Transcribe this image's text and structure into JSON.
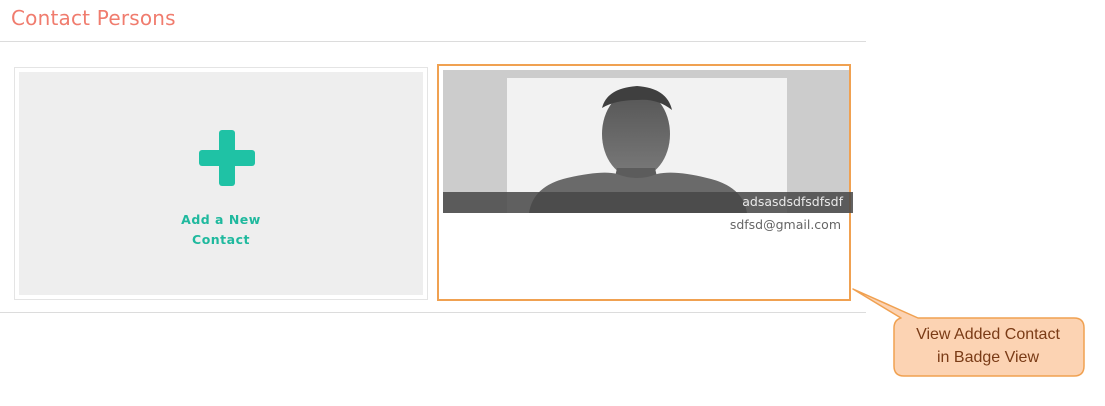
{
  "page": {
    "title": "Contact Persons"
  },
  "add_card": {
    "label": "Add a New Contact"
  },
  "contact": {
    "name": "adsasdsdfsdfsdf",
    "email": "sdfsd@gmail.com"
  },
  "callout": {
    "line1": "View Added Contact",
    "line2": "in Badge View"
  },
  "colors": {
    "title": "#f07c6e",
    "accent": "#1fc2a5",
    "highlight_border": "#f0a151",
    "callout_fill": "#fcd3b3"
  },
  "icons": {
    "add": "plus-icon",
    "avatar": "person-silhouette-icon"
  }
}
